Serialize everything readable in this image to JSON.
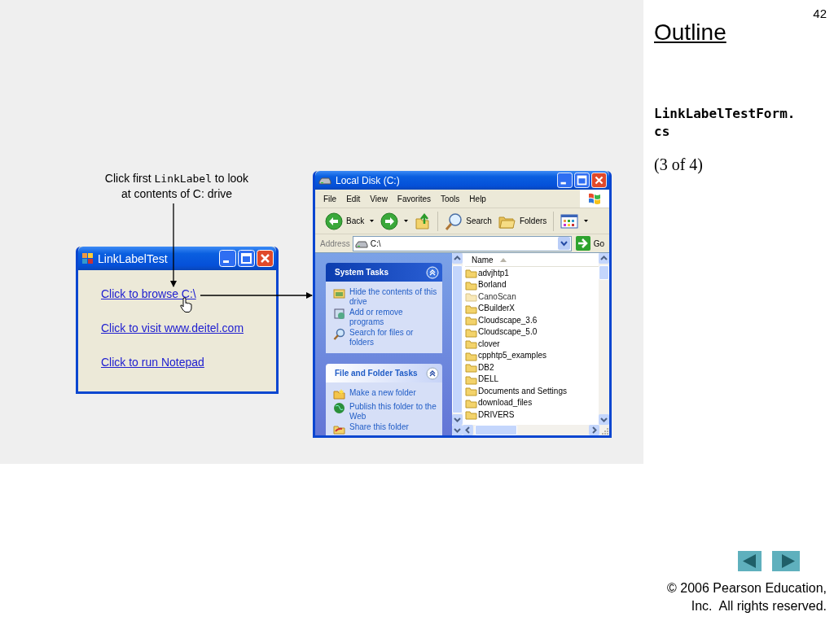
{
  "slide": {
    "page_number": "42",
    "heading": "Outline",
    "file_name": "LinkLabelTestForm.cs",
    "part": "(3 of 4)",
    "copyright": "© 2006 Pearson Education, Inc.  All rights reserved."
  },
  "callout": {
    "segments": [
      {
        "kind": "text",
        "text": "Click first "
      },
      {
        "kind": "code",
        "text": "LinkLabel"
      },
      {
        "kind": "text",
        "text": " to look at contents of C: drive"
      }
    ]
  },
  "form_window": {
    "title": "LinkLabelTest",
    "links": [
      "Click to browse C:\\",
      "Click to visit www.deitel.com",
      "Click to run Notepad"
    ]
  },
  "explorer_window": {
    "title": "Local Disk (C:)",
    "menu": [
      "File",
      "Edit",
      "View",
      "Favorites",
      "Tools",
      "Help"
    ],
    "toolbar": [
      {
        "kind": "back",
        "label": "Back"
      },
      {
        "kind": "forward"
      },
      {
        "kind": "up"
      },
      {
        "kind": "search",
        "label": "Search"
      },
      {
        "kind": "folders",
        "label": "Folders"
      },
      {
        "kind": "views"
      }
    ],
    "address": {
      "label": "Address",
      "value": "C:\\",
      "go": "Go"
    },
    "task_panels": [
      {
        "title": "System Tasks",
        "items": [
          "Hide the contents of this drive",
          "Add or remove programs",
          "Search for files or folders"
        ]
      },
      {
        "title": "File and Folder Tasks",
        "items": [
          "Make a new folder",
          "Publish this folder to the Web",
          "Share this folder"
        ]
      }
    ],
    "column_header": "Name",
    "files": [
      {
        "name": "advjhtp1",
        "dimmed": false
      },
      {
        "name": "Borland",
        "dimmed": false
      },
      {
        "name": "CanoScan",
        "dimmed": true
      },
      {
        "name": "CBuilderX",
        "dimmed": false
      },
      {
        "name": "Cloudscape_3.6",
        "dimmed": false
      },
      {
        "name": "Cloudscape_5.0",
        "dimmed": false
      },
      {
        "name": "clover",
        "dimmed": false
      },
      {
        "name": "cpphtp5_examples",
        "dimmed": false
      },
      {
        "name": "DB2",
        "dimmed": false
      },
      {
        "name": "DELL",
        "dimmed": false
      },
      {
        "name": "Documents and Settings",
        "dimmed": false
      },
      {
        "name": "download_files",
        "dimmed": false
      },
      {
        "name": "DRIVERS",
        "dimmed": false
      }
    ]
  }
}
